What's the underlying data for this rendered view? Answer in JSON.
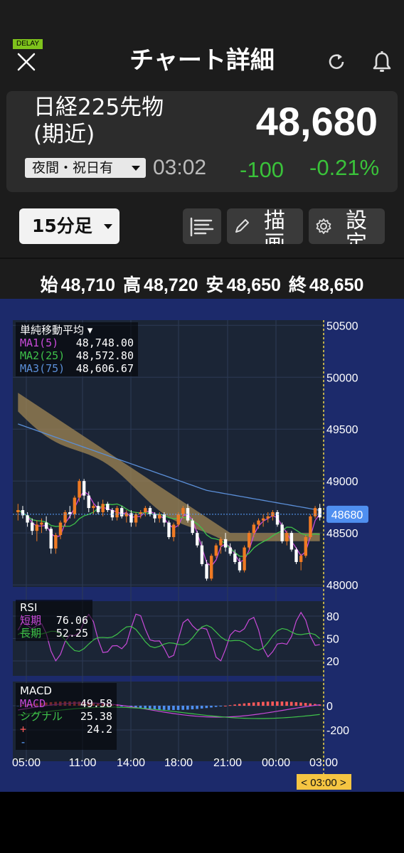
{
  "header": {
    "title": "チャート詳細",
    "delay_badge": "DELAY",
    "close_icon": "close-icon",
    "refresh_icon": "refresh-icon",
    "bell_icon": "bell-icon"
  },
  "quote": {
    "name_line1": "日経225先物",
    "name_line2": "(期近)",
    "price": "48,680",
    "session": "夜間・祝日有",
    "time": "03:02",
    "change": "-100",
    "change_pct": "-0.21%",
    "change_color": "#3ac23a"
  },
  "toolbar": {
    "timeframe": "15分足",
    "draw_label": "描画",
    "settings_label": "設定",
    "indicator_icon": "indicator-list-icon",
    "pencil_icon": "pencil-icon",
    "gear_icon": "gear-icon"
  },
  "ohlc": {
    "open_label": "始",
    "open": "48,710",
    "high_label": "高",
    "high": "48,720",
    "low_label": "安",
    "low": "48,650",
    "close_label": "終",
    "close": "48,650"
  },
  "legend": {
    "ma_title": "単純移動平均",
    "ma": [
      {
        "label": "MA1(5)",
        "value": "48,748.00",
        "color": "#c94ad9"
      },
      {
        "label": "MA2(25)",
        "value": "48,572.80",
        "color": "#3fc24a"
      },
      {
        "label": "MA3(75)",
        "value": "48,606.67",
        "color": "#5b8fd8"
      }
    ],
    "rsi_title": "RSI",
    "rsi": [
      {
        "label": "短期",
        "value": "76.06",
        "color": "#c94ad9"
      },
      {
        "label": "長期",
        "value": "52.25",
        "color": "#3fc24a"
      }
    ],
    "macd_title": "MACD",
    "macd": [
      {
        "label": "MACD",
        "value": "49.58",
        "color": "#c94ad9"
      },
      {
        "label": "シグナル",
        "value": "25.38",
        "color": "#3fc24a"
      },
      {
        "label": "+",
        "value": "24.2",
        "color": "#ff5a5a"
      },
      {
        "label": "-",
        "value": "",
        "color": "#5aa0ff"
      }
    ]
  },
  "current_price_tag": "48680",
  "time_cursor": "< 03:00 >",
  "chart_data": {
    "type": "candlestick",
    "price_axis": {
      "ticks": [
        "50500",
        "50000",
        "49500",
        "49000",
        "48500",
        "48000"
      ],
      "range": [
        47980,
        50550
      ]
    },
    "rsi_axis": {
      "ticks": [
        "80",
        "50",
        "20"
      ]
    },
    "macd_axis": {
      "ticks": [
        "0",
        "-200"
      ]
    },
    "time_axis": {
      "ticks": [
        "05:00",
        "11:00",
        "14:00",
        "18:00",
        "21:00",
        "00:00",
        "03:00"
      ]
    },
    "candles": [
      [
        48700,
        48780,
        48620,
        48720
      ],
      [
        48720,
        48760,
        48640,
        48670
      ],
      [
        48670,
        48700,
        48560,
        48600
      ],
      [
        48600,
        48640,
        48480,
        48520
      ],
      [
        48520,
        48620,
        48420,
        48580
      ],
      [
        48580,
        48640,
        48500,
        48600
      ],
      [
        48600,
        48660,
        48520,
        48540
      ],
      [
        48540,
        48560,
        48300,
        48350
      ],
      [
        48350,
        48500,
        48300,
        48480
      ],
      [
        48480,
        48620,
        48440,
        48600
      ],
      [
        48600,
        48720,
        48560,
        48700
      ],
      [
        48700,
        48760,
        48640,
        48680
      ],
      [
        48680,
        48860,
        48640,
        48840
      ],
      [
        48840,
        49020,
        48800,
        49000
      ],
      [
        49000,
        49020,
        48820,
        48860
      ],
      [
        48860,
        48900,
        48700,
        48740
      ],
      [
        48740,
        48780,
        48680,
        48760
      ],
      [
        48760,
        48800,
        48680,
        48700
      ],
      [
        48700,
        48820,
        48660,
        48780
      ],
      [
        48780,
        48800,
        48700,
        48720
      ],
      [
        48720,
        48740,
        48620,
        48650
      ],
      [
        48650,
        48760,
        48620,
        48740
      ],
      [
        48740,
        48760,
        48640,
        48660
      ],
      [
        48660,
        48720,
        48600,
        48690
      ],
      [
        48690,
        48720,
        48560,
        48600
      ],
      [
        48600,
        48700,
        48560,
        48680
      ],
      [
        48680,
        48720,
        48640,
        48700
      ],
      [
        48700,
        48760,
        48660,
        48740
      ],
      [
        48740,
        48760,
        48660,
        48680
      ],
      [
        48680,
        48700,
        48600,
        48640
      ],
      [
        48640,
        48700,
        48600,
        48680
      ],
      [
        48680,
        48700,
        48560,
        48600
      ],
      [
        48600,
        48620,
        48440,
        48460
      ],
      [
        48460,
        48600,
        48420,
        48580
      ],
      [
        48580,
        48700,
        48560,
        48680
      ],
      [
        48680,
        48760,
        48640,
        48740
      ],
      [
        48740,
        48780,
        48600,
        48620
      ],
      [
        48620,
        48640,
        48480,
        48500
      ],
      [
        48500,
        48520,
        48360,
        48380
      ],
      [
        48380,
        48420,
        48180,
        48200
      ],
      [
        48200,
        48240,
        48040,
        48060
      ],
      [
        48060,
        48300,
        48040,
        48280
      ],
      [
        48280,
        48400,
        48260,
        48380
      ],
      [
        48380,
        48460,
        48300,
        48440
      ],
      [
        48440,
        48500,
        48320,
        48360
      ],
      [
        48360,
        48400,
        48280,
        48300
      ],
      [
        48300,
        48340,
        48200,
        48220
      ],
      [
        48220,
        48260,
        48120,
        48140
      ],
      [
        48140,
        48380,
        48120,
        48360
      ],
      [
        48360,
        48520,
        48340,
        48500
      ],
      [
        48500,
        48600,
        48460,
        48580
      ],
      [
        48580,
        48640,
        48540,
        48620
      ],
      [
        48620,
        48680,
        48560,
        48640
      ],
      [
        48640,
        48700,
        48600,
        48660
      ],
      [
        48660,
        48720,
        48620,
        48700
      ],
      [
        48700,
        48720,
        48560,
        48580
      ],
      [
        48580,
        48600,
        48400,
        48420
      ],
      [
        48420,
        48520,
        48380,
        48500
      ],
      [
        48500,
        48520,
        48320,
        48340
      ],
      [
        48340,
        48360,
        48200,
        48220
      ],
      [
        48220,
        48300,
        48140,
        48280
      ],
      [
        48280,
        48480,
        48260,
        48460
      ],
      [
        48460,
        48680,
        48440,
        48660
      ],
      [
        48660,
        48760,
        48640,
        48740
      ],
      [
        48740,
        48780,
        48620,
        48650
      ]
    ]
  }
}
